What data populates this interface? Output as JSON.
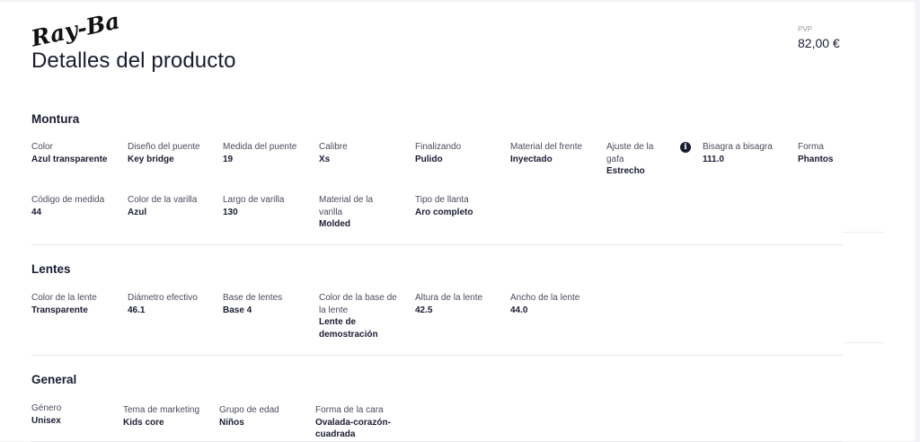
{
  "brand": "Ray-Ban",
  "page_title": "Detalles del producto",
  "price": {
    "label": "PVP",
    "value": "82,00 €"
  },
  "sections": {
    "frame": {
      "title": "Montura",
      "attributes": [
        {
          "label": "Color",
          "value": "Azul transparente"
        },
        {
          "label": "Diseño del puente",
          "value": "Key bridge"
        },
        {
          "label": "Medida del puente",
          "value": "19"
        },
        {
          "label": "Calibre",
          "value": "Xs"
        },
        {
          "label": "Finalizando",
          "value": "Pulido"
        },
        {
          "label": "Material del frente",
          "value": "Inyectado"
        },
        {
          "label": "Ajuste de la gafa",
          "value": "Estrecho"
        },
        {
          "label": "Bisagra a bisagra",
          "value": "111.0"
        },
        {
          "label": "Forma",
          "value": "Phantos"
        },
        {
          "label": "Código de medida",
          "value": "44"
        },
        {
          "label": "Color de la varilla",
          "value": "Azul"
        },
        {
          "label": "Largo de varilla",
          "value": "130"
        },
        {
          "label": "Material de la varilla",
          "value": "Molded"
        },
        {
          "label": "Tipo de llanta",
          "value": "Aro completo"
        }
      ]
    },
    "lenses": {
      "title": "Lentes",
      "attributes": [
        {
          "label": "Color de la lente",
          "value": "Transparente"
        },
        {
          "label": "Diámetro efectivo",
          "value": "46.1"
        },
        {
          "label": "Base de lentes",
          "value": "Base 4"
        },
        {
          "label": "Color de la base de la lente",
          "value": "Lente de demostración"
        },
        {
          "label": "Altura de la lente",
          "value": "42.5"
        },
        {
          "label": "Ancho de la lente",
          "value": "44.0"
        }
      ]
    },
    "general": {
      "title": "General",
      "attributes": [
        {
          "label": "Género",
          "value": "Unisex"
        },
        {
          "label": "Tema de marketing",
          "value": "Kids core"
        },
        {
          "label": "Grupo de edad",
          "value": "Niños"
        },
        {
          "label": "Forma de la cara",
          "value": "Ovalada-corazón-cuadrada"
        }
      ]
    }
  },
  "icons": {
    "info": "info-icon"
  }
}
